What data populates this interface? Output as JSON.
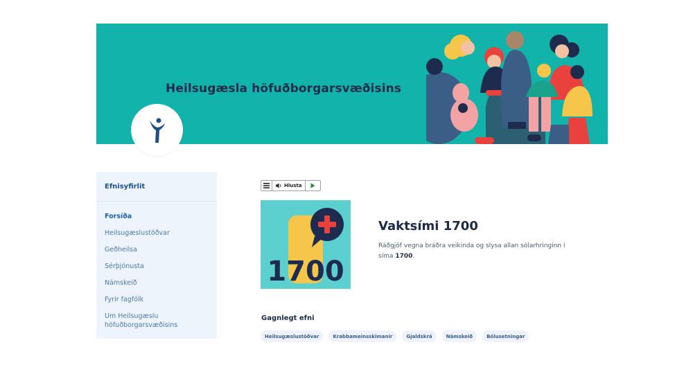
{
  "header": {
    "title": "Heilsugæsla höfuðborgarsvæðisins",
    "logo_icon": "person-raising-arms-icon",
    "background_color": "#12b3aa"
  },
  "sidebar": {
    "heading": "Efnisyfirlit",
    "items": [
      {
        "label": "Forsíða",
        "active": true
      },
      {
        "label": "Heilsugæslustöðvar",
        "active": false
      },
      {
        "label": "Geðheilsa",
        "active": false
      },
      {
        "label": "Sérþjónusta",
        "active": false
      },
      {
        "label": "Námskeið",
        "active": false
      },
      {
        "label": "Fyrir fagfólk",
        "active": false
      },
      {
        "label": "Um Heilsugæslu höfuðborgarsvæðisins",
        "active": false
      }
    ]
  },
  "listen_bar": {
    "menu_icon": "hamburger-menu-icon",
    "speaker_icon": "speaker-icon",
    "label": "Hlusta",
    "play_icon": "play-icon"
  },
  "feature": {
    "image_number": "1700",
    "title": "Vaktsími 1700",
    "description_prefix": "Ráðgjöf vegna bráðra veikinda og slysa allan sólarhringinn í síma ",
    "description_number": "1700",
    "description_suffix": "."
  },
  "useful": {
    "heading": "Gagnlegt efni",
    "tags": [
      "Heilsugæslustöðvar",
      "Krabbameinsskimanir",
      "Gjaldskrá",
      "Námskeið",
      "Bólusetningar"
    ]
  }
}
